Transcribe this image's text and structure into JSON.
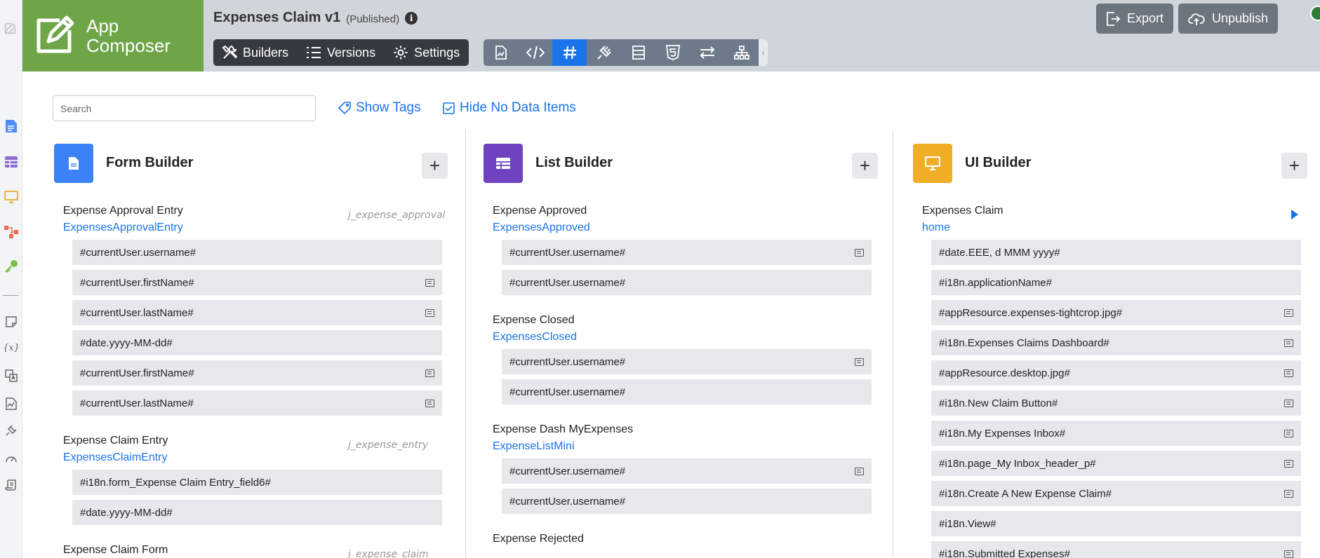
{
  "app": {
    "brand_line1": "App",
    "brand_line2": "Composer",
    "title": "Expenses Claim v1",
    "status": "(Published)",
    "info_icon": "i"
  },
  "nav": {
    "builders": "Builders",
    "versions": "Versions",
    "settings": "Settings"
  },
  "tools": [
    "chart-file-icon",
    "code-icon",
    "hash-icon",
    "plug-icon",
    "list-icon",
    "html5-icon",
    "exchange-icon",
    "sitemap-icon"
  ],
  "header_actions": {
    "export": "Export",
    "unpublish": "Unpublish"
  },
  "toolbar": {
    "search_placeholder": "Search",
    "show_tags": "Show Tags",
    "hide_no_data": "Hide No Data Items"
  },
  "colors": {
    "brand": "#6ea547",
    "form": "#3b82f6",
    "list": "#6f42c1",
    "ui": "#f0ad26",
    "link": "#1a73e8"
  },
  "form_builder": {
    "title": "Form Builder",
    "add": "+",
    "groups": [
      {
        "label": "Expense Approval Entry",
        "link": "ExpensesApprovalEntry",
        "table": "j_expense_approval",
        "rows": [
          {
            "text": "#currentUser.username#",
            "note": false
          },
          {
            "text": "#currentUser.firstName#",
            "note": true
          },
          {
            "text": "#currentUser.lastName#",
            "note": true
          },
          {
            "text": "#date.yyyy-MM-dd#",
            "note": false
          },
          {
            "text": "#currentUser.firstName#",
            "note": true
          },
          {
            "text": "#currentUser.lastName#",
            "note": true
          }
        ]
      },
      {
        "label": "Expense Claim Entry",
        "link": "ExpensesClaimEntry",
        "table": "j_expense_entry",
        "rows": [
          {
            "text": "#i18n.form_Expense Claim Entry_field6#",
            "note": false
          },
          {
            "text": "#date.yyyy-MM-dd#",
            "note": false
          }
        ]
      },
      {
        "label": "Expense Claim Form",
        "link": "",
        "table": "j_expense_claim",
        "rows": []
      }
    ]
  },
  "list_builder": {
    "title": "List Builder",
    "add": "+",
    "groups": [
      {
        "label": "Expense Approved",
        "link": "ExpensesApproved",
        "rows": [
          {
            "text": "#currentUser.username#",
            "note": true
          },
          {
            "text": "#currentUser.username#",
            "note": false
          }
        ]
      },
      {
        "label": "Expense Closed",
        "link": "ExpensesClosed",
        "rows": [
          {
            "text": "#currentUser.username#",
            "note": true
          },
          {
            "text": "#currentUser.username#",
            "note": false
          }
        ]
      },
      {
        "label": "Expense Dash MyExpenses",
        "link": "ExpenseListMini",
        "rows": [
          {
            "text": "#currentUser.username#",
            "note": true
          },
          {
            "text": "#currentUser.username#",
            "note": false
          }
        ]
      },
      {
        "label": "Expense Rejected",
        "link": "",
        "rows": []
      }
    ]
  },
  "ui_builder": {
    "title": "UI Builder",
    "add": "+",
    "groups": [
      {
        "label": "Expenses Claim",
        "link": "home",
        "rows": [
          {
            "text": "#date.EEE, d MMM yyyy#",
            "note": false
          },
          {
            "text": "#i18n.applicationName#",
            "note": false
          },
          {
            "text": "#appResource.expenses-tightcrop.jpg#",
            "note": true
          },
          {
            "text": "#i18n.Expenses Claims Dashboard#",
            "note": true
          },
          {
            "text": "#appResource.desktop.jpg#",
            "note": true
          },
          {
            "text": "#i18n.New Claim Button#",
            "note": true
          },
          {
            "text": "#i18n.My Expenses Inbox#",
            "note": true
          },
          {
            "text": "#i18n.page_My Inbox_header_p#",
            "note": true
          },
          {
            "text": "#i18n.Create A New Expense Claim#",
            "note": true
          },
          {
            "text": "#i18n.View#",
            "note": false
          },
          {
            "text": "#i18n.Submitted Expenses#",
            "note": true
          }
        ]
      }
    ]
  }
}
